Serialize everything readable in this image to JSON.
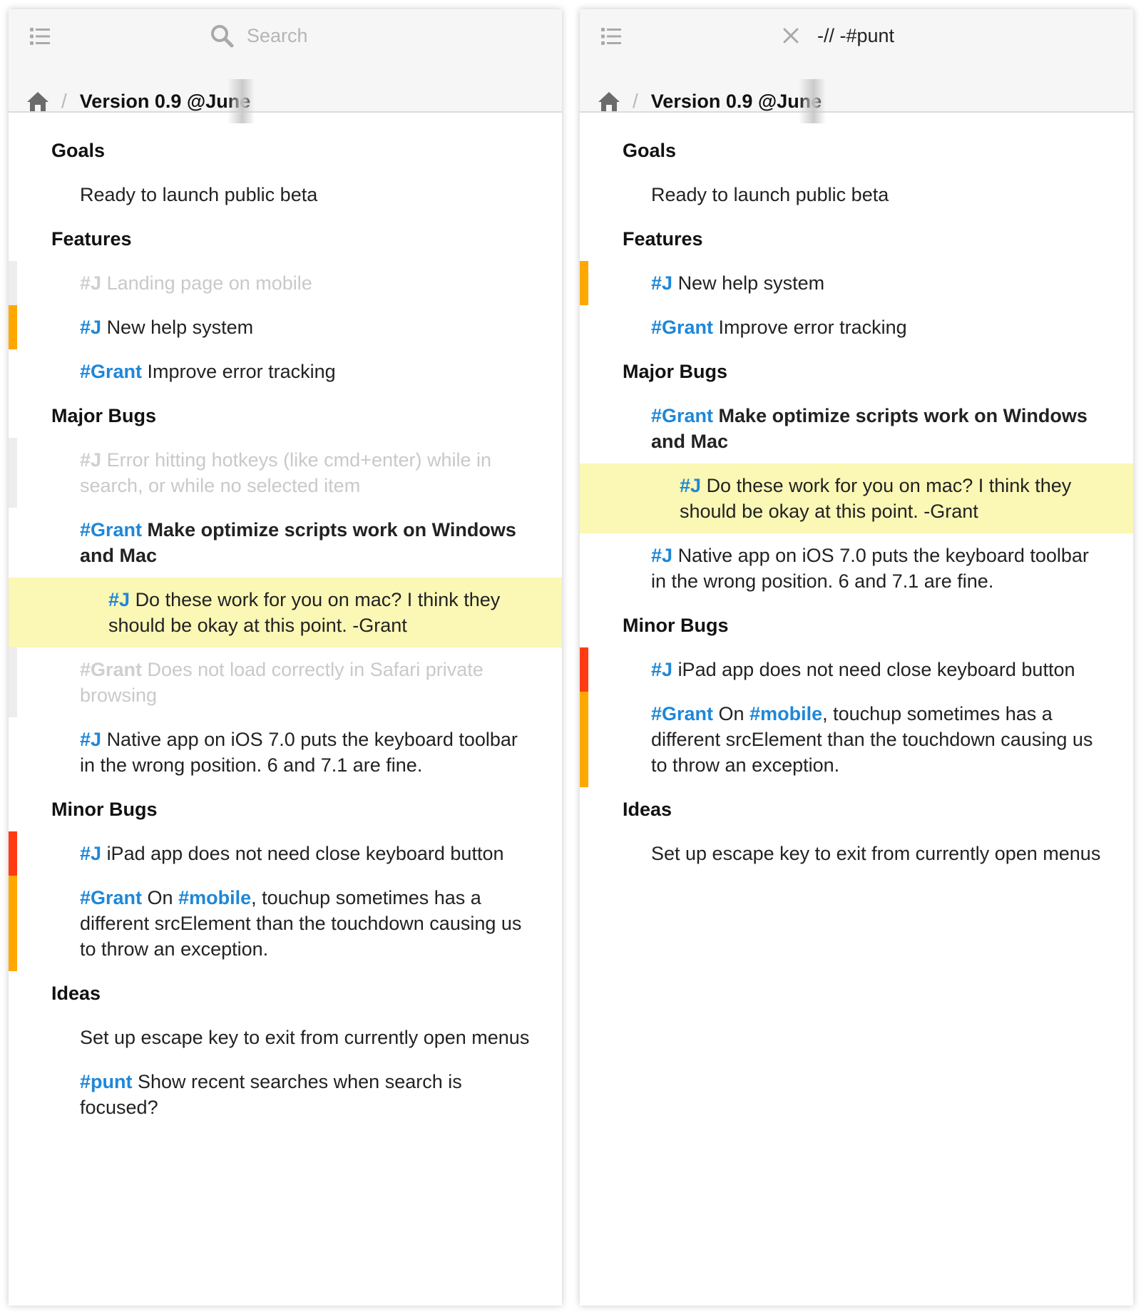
{
  "colors": {
    "tag": "#1e87d8",
    "orange_marker": "#ffa800",
    "red_marker": "#ff3b13",
    "done_marker": "#ededed",
    "highlight": "#fbf7b5"
  },
  "left_panel": {
    "search_placeholder": "Search",
    "search_value": "",
    "breadcrumb_title": "Version 0.9 @June",
    "rows": [
      {
        "type": "heading",
        "text": "Goals"
      },
      {
        "type": "item",
        "text": "Ready to launch public beta"
      },
      {
        "type": "heading",
        "text": "Features"
      },
      {
        "type": "item",
        "tag": "#J",
        "text": "Landing page on mobile",
        "done": true
      },
      {
        "type": "item",
        "tag": "#J",
        "text": "New help system",
        "marker": "orange"
      },
      {
        "type": "item",
        "tag": "#Grant",
        "text": "Improve error tracking"
      },
      {
        "type": "heading",
        "text": "Major Bugs"
      },
      {
        "type": "item",
        "tag": "#J",
        "text": "Error hitting hotkeys (like cmd+enter) while in search, or while no selected item",
        "done": true
      },
      {
        "type": "item",
        "tag": "#Grant",
        "text": "Make optimize scripts work on Windows and Mac",
        "bold": true
      },
      {
        "type": "subitem",
        "tag": "#J",
        "text": "Do these work for you on mac? I think they should be okay at this point. -Grant",
        "highlight": true
      },
      {
        "type": "item",
        "tag": "#Grant",
        "text": "Does not load correctly in Safari private browsing",
        "done": true
      },
      {
        "type": "item",
        "tag": "#J",
        "text": "Native app on iOS 7.0 puts the keyboard toolbar in the wrong position. 6 and 7.1 are fine."
      },
      {
        "type": "heading",
        "text": "Minor Bugs"
      },
      {
        "type": "item",
        "tag": "#J",
        "text": "iPad app does not need close keyboard button",
        "marker": "red"
      },
      {
        "type": "item",
        "tag": "#Grant",
        "text": "On ",
        "tag2": "#mobile",
        "text2": ", touchup sometimes has a different srcElement than the touchdown causing us to throw an exception.",
        "marker": "orange"
      },
      {
        "type": "heading",
        "text": "Ideas"
      },
      {
        "type": "item",
        "text": "Set up escape key to exit from currently open menus"
      },
      {
        "type": "item",
        "tag": "#punt",
        "text": "Show recent searches when search is focused?"
      }
    ]
  },
  "right_panel": {
    "search_placeholder": "Search",
    "search_value": "-// -#punt",
    "breadcrumb_title": "Version 0.9 @June",
    "rows": [
      {
        "type": "heading",
        "text": "Goals"
      },
      {
        "type": "item",
        "text": "Ready to launch public beta"
      },
      {
        "type": "heading",
        "text": "Features"
      },
      {
        "type": "item",
        "tag": "#J",
        "text": "New help system",
        "marker": "orange"
      },
      {
        "type": "item",
        "tag": "#Grant",
        "text": "Improve error tracking"
      },
      {
        "type": "heading",
        "text": "Major Bugs"
      },
      {
        "type": "item",
        "tag": "#Grant",
        "text": "Make optimize scripts work on Windows and Mac",
        "bold": true
      },
      {
        "type": "subitem",
        "tag": "#J",
        "text": "Do these work for you on mac? I think they should be okay at this point. -Grant",
        "highlight": true
      },
      {
        "type": "item",
        "tag": "#J",
        "text": "Native app on iOS 7.0 puts the keyboard toolbar in the wrong position. 6 and 7.1 are fine."
      },
      {
        "type": "heading",
        "text": "Minor Bugs"
      },
      {
        "type": "item",
        "tag": "#J",
        "text": "iPad app does not need close keyboard button",
        "marker": "red"
      },
      {
        "type": "item",
        "tag": "#Grant",
        "text": "On ",
        "tag2": "#mobile",
        "text2": ", touchup sometimes has a different srcElement than the touchdown causing us to throw an exception.",
        "marker": "orange"
      },
      {
        "type": "heading",
        "text": "Ideas"
      },
      {
        "type": "item",
        "text": "Set up escape key to exit from currently open menus"
      }
    ]
  }
}
